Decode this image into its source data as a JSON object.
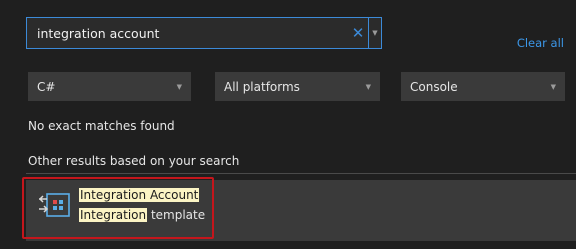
{
  "search": {
    "value": "integration account",
    "clear_icon": "close-icon",
    "dropdown_icon": "chevron-down-icon"
  },
  "clear_all_label": "Clear all",
  "filters": {
    "language": "C#",
    "platform": "All platforms",
    "project_type": "Console"
  },
  "messages": {
    "no_matches": "No exact matches found",
    "other_results": "Other results based on your search"
  },
  "result": {
    "title": "Integration Account",
    "desc_highlight": "Integration",
    "desc_rest": " template",
    "icon": "integration-account-icon"
  },
  "colors": {
    "accent": "#3c8ad8",
    "highlight": "#fbf4c4",
    "annotation_box": "#c4161c"
  }
}
